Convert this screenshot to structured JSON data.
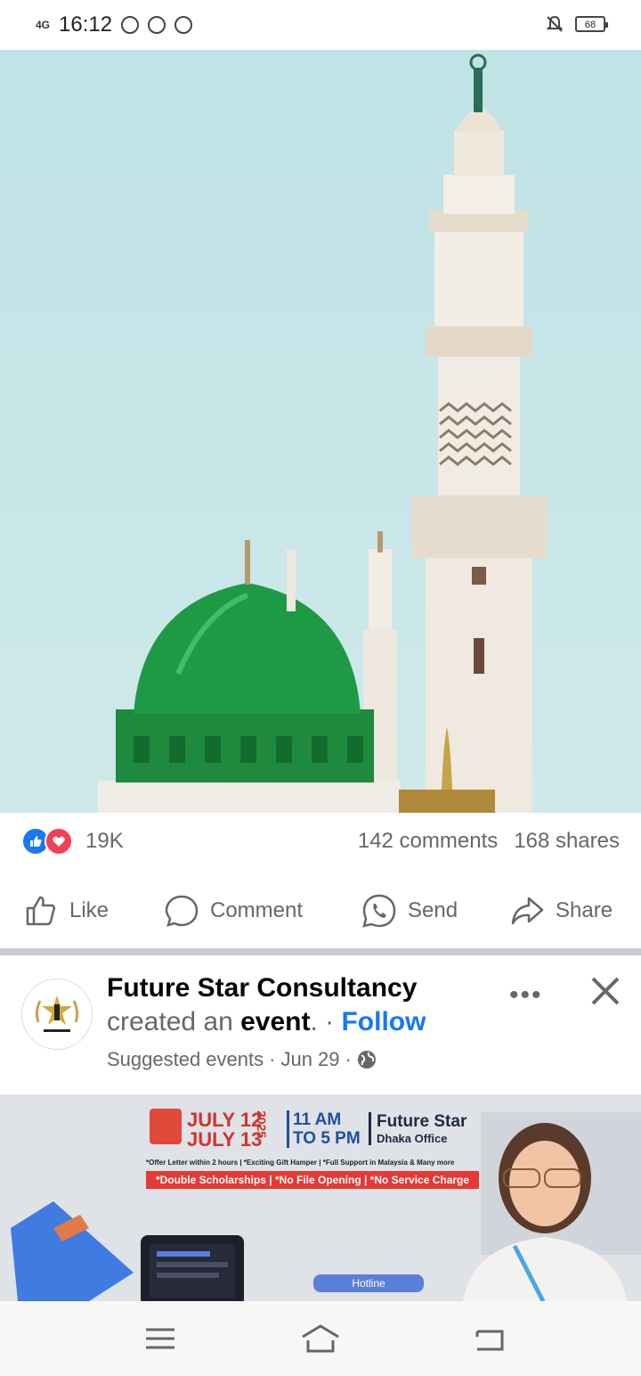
{
  "status_bar": {
    "network": "4G",
    "time": "16:12",
    "battery": "68"
  },
  "post": {
    "reaction_count": "19K",
    "comments": "142 comments",
    "shares": "168 shares",
    "actions": {
      "like": "Like",
      "comment": "Comment",
      "send": "Send",
      "share": "Share"
    }
  },
  "suggested_post": {
    "page_name": "Future Star Consultancy",
    "line_prefix": "created an ",
    "line_bold": "event",
    "line_sep": ". · ",
    "follow": "Follow",
    "meta_label": "Suggested events",
    "date": "Jun 29",
    "more": "•••",
    "banner": {
      "date1": "JULY 12",
      "date2": "JULY 13",
      "year": "2025",
      "time1": "11 AM",
      "time2": "TO 5 PM",
      "brand": "Future Star",
      "brand_sub": "Dhaka Office",
      "small_text": "*Offer Letter within 2 hours | *Exciting Gift Hamper | *Full Support in Malaysia & Many more",
      "red_text": "*Double Scholarships | *No File Opening | *No Service Charge",
      "hotline": "Hotline"
    }
  },
  "colors": {
    "fb_blue": "#1877f2",
    "love_red": "#f33e58",
    "dome_green": "#1e8a3e"
  }
}
